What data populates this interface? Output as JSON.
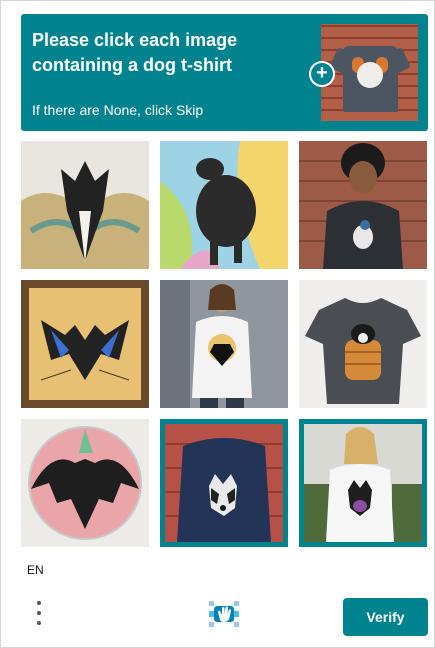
{
  "header": {
    "prompt": "Please click each image containing a dog t-shirt",
    "subprompt": "If there are None, click Skip",
    "example_icon": "plus-icon"
  },
  "tiles": [
    {
      "description_icon": "bat-drawing",
      "selected": false
    },
    {
      "description_icon": "black-animal-painting",
      "selected": false
    },
    {
      "description_icon": "man-in-tshirt",
      "selected": false
    },
    {
      "description_icon": "bat-painting",
      "selected": false
    },
    {
      "description_icon": "woman-in-tshirt",
      "selected": false
    },
    {
      "description_icon": "tshirt-with-dog",
      "selected": false
    },
    {
      "description_icon": "bat-illustration",
      "selected": false
    },
    {
      "description_icon": "man-in-dog-tshirt",
      "selected": true
    },
    {
      "description_icon": "woman-in-dog-tshirt",
      "selected": true
    }
  ],
  "footer": {
    "language": "EN",
    "verify_label": "Verify",
    "menu_icon": "more-vertical-icon",
    "logo_icon": "hcaptcha-logo-icon"
  },
  "colors": {
    "accent": "#00838f"
  }
}
